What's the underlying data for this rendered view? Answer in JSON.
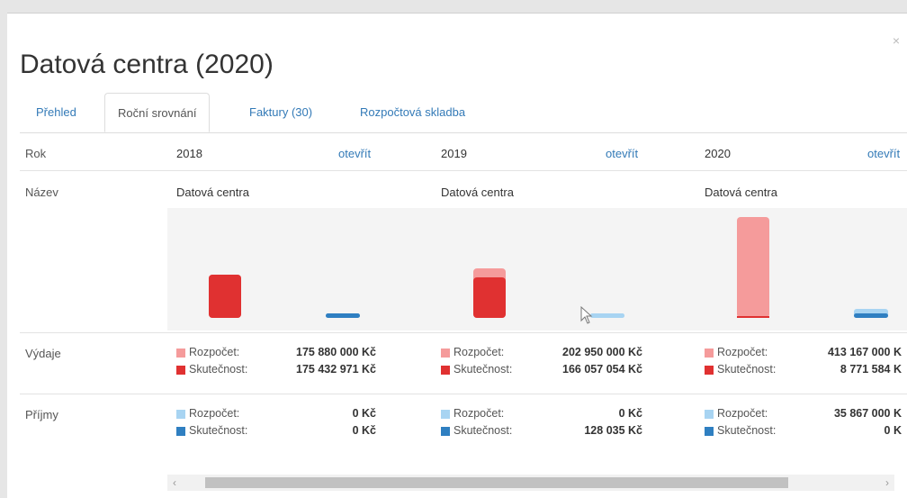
{
  "modal": {
    "title": "Datová centra (2020)",
    "close": "×"
  },
  "tabs": [
    {
      "label": "Přehled"
    },
    {
      "label": "Roční srovnání"
    },
    {
      "label": "Faktury (30)"
    },
    {
      "label": "Rozpočtová skladba"
    }
  ],
  "rows": {
    "rok": "Rok",
    "nazev": "Název",
    "vydaje": "Výdaje",
    "prijmy": "Příjmy"
  },
  "legend": {
    "rozpocet": "Rozpočet:",
    "skutecnost": "Skutečnost:"
  },
  "open_label": "otevřít",
  "colors": {
    "vydaje_rozpocet": "#f59b9b",
    "vydaje_skutecnost": "#e03131",
    "prijmy_rozpocet": "#a8d4f2",
    "prijmy_skutecnost": "#2f7fc1"
  },
  "years": [
    {
      "year": "2018",
      "name": "Datová centra",
      "vydaje": {
        "rozpocet": "175 880 000 Kč",
        "skutecnost": "175 432 971 Kč"
      },
      "prijmy": {
        "rozpocet": "0 Kč",
        "skutecnost": "0 Kč"
      }
    },
    {
      "year": "2019",
      "name": "Datová centra",
      "vydaje": {
        "rozpocet": "202 950 000 Kč",
        "skutecnost": "166 057 054 Kč"
      },
      "prijmy": {
        "rozpocet": "0 Kč",
        "skutecnost": "128 035 Kč"
      }
    },
    {
      "year": "2020",
      "name": "Datová centra",
      "vydaje": {
        "rozpocet": "413 167 000 K",
        "skutecnost": "8 771 584 K"
      },
      "prijmy": {
        "rozpocet": "35 867 000 K",
        "skutecnost": "0 K"
      }
    }
  ],
  "chart_data": {
    "type": "bar",
    "categories": [
      "2018",
      "2019",
      "2020"
    ],
    "groups": [
      "Výdaje",
      "Příjmy"
    ],
    "series": [
      {
        "name": "Výdaje Rozpočet",
        "values": [
          175880000,
          202950000,
          413167000
        ]
      },
      {
        "name": "Výdaje Skutečnost",
        "values": [
          175432971,
          166057054,
          8771584
        ]
      },
      {
        "name": "Příjmy Rozpočet",
        "values": [
          0,
          0,
          35867000
        ]
      },
      {
        "name": "Příjmy Skutečnost",
        "values": [
          0,
          128035,
          0
        ]
      }
    ],
    "ylim": [
      0,
      413167000
    ]
  },
  "scrollbar": {
    "left": "‹",
    "right": "›"
  }
}
